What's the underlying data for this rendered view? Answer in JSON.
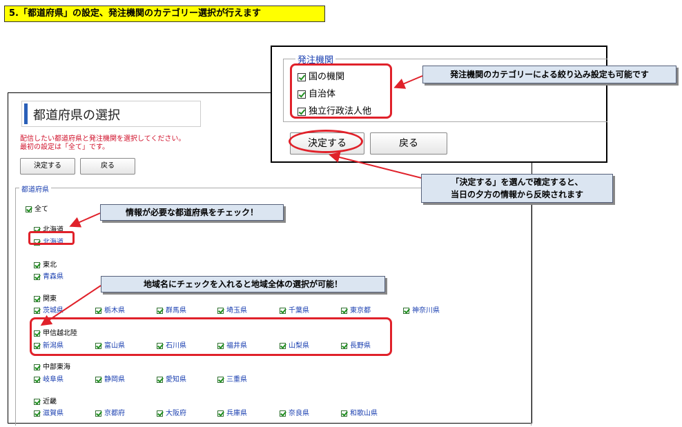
{
  "heading": "5.「都道府県」の設定、発注機関のカテゴリー選択が行えます",
  "main": {
    "title": "都道府県の選択",
    "instructions": [
      "配信したい都道府県と発注機関を選択してください。",
      "最初の設定は「全て」です。"
    ],
    "buttons": {
      "decide": "決定する",
      "back": "戻る"
    },
    "fieldset_label": "都道府県",
    "all_label": "全て",
    "regions": [
      {
        "name": "北海道",
        "prefs": [
          "北海道"
        ]
      },
      {
        "name": "東北",
        "prefs": [
          "青森県"
        ]
      },
      {
        "name": "関東",
        "prefs": [
          "茨城県",
          "栃木県",
          "群馬県",
          "埼玉県",
          "千葉県",
          "東京都",
          "神奈川県"
        ]
      },
      {
        "name": "甲信越北陸",
        "prefs": [
          "新潟県",
          "富山県",
          "石川県",
          "福井県",
          "山梨県",
          "長野県"
        ]
      },
      {
        "name": "中部東海",
        "prefs": [
          "岐阜県",
          "静岡県",
          "愛知県",
          "三重県"
        ]
      },
      {
        "name": "近畿",
        "prefs": [
          "滋賀県",
          "京都府",
          "大阪府",
          "兵庫県",
          "奈良県",
          "和歌山県"
        ]
      }
    ]
  },
  "agency": {
    "legend": "発注機関",
    "options": [
      "国の機関",
      "自治体",
      "独立行政法人他"
    ],
    "buttons": {
      "decide": "決定する",
      "back": "戻る"
    }
  },
  "callouts": {
    "agency": "発注機関のカテゴリーによる絞り込み設定も可能です",
    "decide_line1": "「決定する」を選んで確定すると、",
    "decide_line2": "当日の夕方の情報から反映されます",
    "check_pref": "情報が必要な都道府県をチェック！",
    "check_region": "地域名にチェックを入れると地域全体の選択が可能！"
  },
  "colors": {
    "heading_bg": "#ffff00",
    "callout_bg": "#dbe5f1",
    "highlight": "#e0212a",
    "pref_link": "#1a3fb0",
    "title_accent": "#2a5fb8"
  }
}
